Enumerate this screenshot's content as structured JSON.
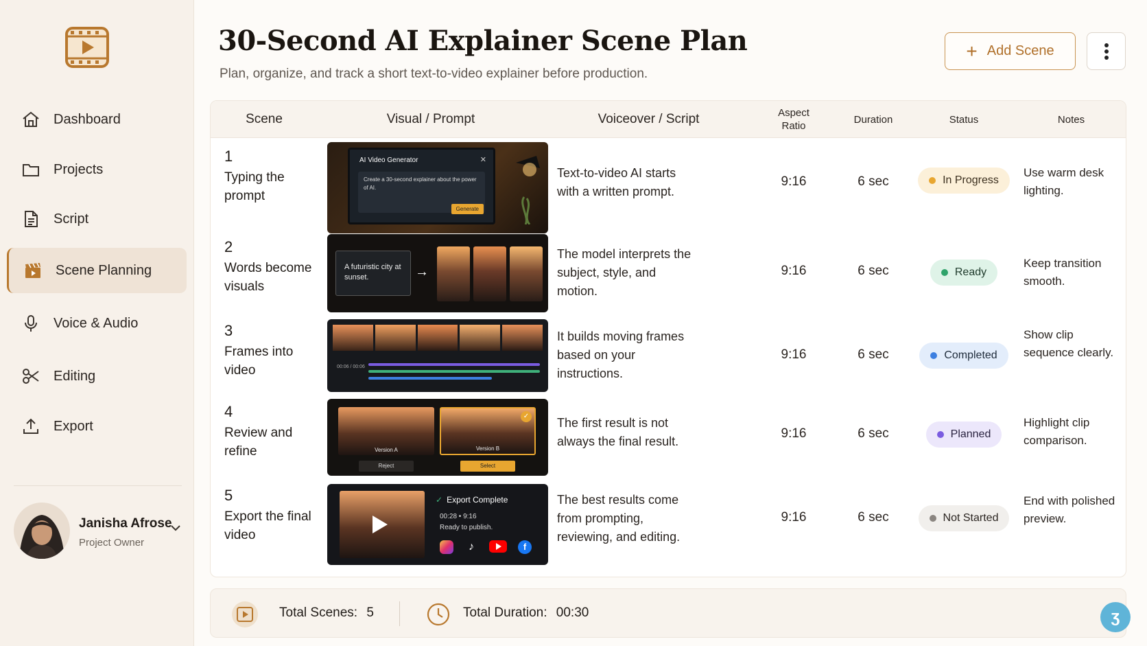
{
  "sidebar": {
    "items": [
      {
        "label": "Dashboard",
        "icon": "home-icon"
      },
      {
        "label": "Projects",
        "icon": "folder-icon"
      },
      {
        "label": "Script",
        "icon": "document-icon"
      },
      {
        "label": "Scene Planning",
        "icon": "clapperboard-icon",
        "active": true
      },
      {
        "label": "Voice & Audio",
        "icon": "microphone-icon"
      },
      {
        "label": "Editing",
        "icon": "scissors-icon"
      },
      {
        "label": "Export",
        "icon": "upload-icon"
      }
    ],
    "user": {
      "name": "Janisha Afrose",
      "role": "Project Owner"
    }
  },
  "header": {
    "title": "30-Second AI Explainer Scene Plan",
    "subtitle": "Plan, organize, and track a short text-to-video explainer before production.",
    "add_label": "Add Scene"
  },
  "table": {
    "headers": {
      "scene": "Scene",
      "visual": "Visual / Prompt",
      "voiceover": "Voiceover / Script",
      "aspect_line1": "Aspect",
      "aspect_line2": "Ratio",
      "duration": "Duration",
      "status": "Status",
      "notes": "Notes"
    },
    "rows": [
      {
        "num": "1",
        "title": "Typing the prompt",
        "voiceover": "Text-to-video AI starts with a written prompt.",
        "ratio": "9:16",
        "duration": "6 sec",
        "status": "In Progress",
        "notes": "Use warm desk lighting.",
        "thumb": {
          "window_title": "AI Video Generator",
          "prompt": "Create a 30-second explainer about the power of AI.",
          "button": "Generate"
        }
      },
      {
        "num": "2",
        "title": "Words become visuals",
        "voiceover": "The model interprets the subject, style, and motion.",
        "ratio": "9:16",
        "duration": "6 sec",
        "status": "Ready",
        "notes": "Keep transition smooth.",
        "thumb": {
          "prompt": "A futuristic city at sunset."
        }
      },
      {
        "num": "3",
        "title": "Frames into video",
        "voiceover": "It builds moving frames based on your instructions.",
        "ratio": "9:16",
        "duration": "6 sec",
        "status": "Completed",
        "notes": "Show clip sequence clearly.",
        "thumb": {
          "timecode": "00:06 / 00:06"
        }
      },
      {
        "num": "4",
        "title": "Review and refine",
        "voiceover": "The first result is not always the final result.",
        "ratio": "9:16",
        "duration": "6 sec",
        "status": "Planned",
        "notes": "Highlight clip comparison.",
        "thumb": {
          "version_a": "Version A",
          "version_b": "Version B",
          "reject": "Reject",
          "select": "Select"
        }
      },
      {
        "num": "5",
        "title": "Export the final video",
        "voiceover": "The best results come from prompting, reviewing, and editing.",
        "ratio": "9:16",
        "duration": "6 sec",
        "status": "Not Started",
        "notes": "End with polished preview.",
        "thumb": {
          "export_title": "Export Complete",
          "meta": "00:28 • 9:16",
          "ready": "Ready to publish."
        }
      }
    ]
  },
  "footer": {
    "scenes_label": "Total Scenes:",
    "scenes_value": "5",
    "duration_label": "Total Duration:",
    "duration_value": "00:30"
  },
  "colors": {
    "accent": "#b8782e",
    "in_progress": "#e8a630",
    "ready": "#2fa36b",
    "completed": "#3d7fe0",
    "planned": "#7a5ce0",
    "not_started": "#8a8580"
  }
}
